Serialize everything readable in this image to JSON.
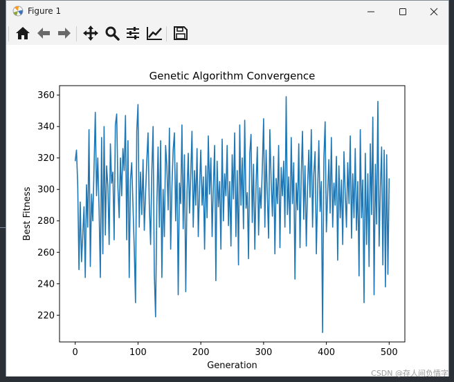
{
  "window": {
    "title": "Figure 1",
    "minimize_icon": "minimize-icon",
    "maximize_icon": "maximize-icon",
    "close_icon": "close-icon"
  },
  "toolbar": {
    "buttons": [
      {
        "name": "home",
        "icon": "home-icon"
      },
      {
        "name": "back",
        "icon": "arrow-left-icon"
      },
      {
        "name": "forward",
        "icon": "arrow-right-icon"
      },
      {
        "name": "pan",
        "icon": "move-icon"
      },
      {
        "name": "zoom",
        "icon": "magnifier-icon"
      },
      {
        "name": "configure-subplots",
        "icon": "sliders-icon"
      },
      {
        "name": "edit-axis",
        "icon": "line-chart-icon"
      },
      {
        "name": "save",
        "icon": "floppy-disk-icon"
      }
    ]
  },
  "chart_data": {
    "type": "line",
    "title": "Genetic Algorithm Convergence",
    "xlabel": "Generation",
    "ylabel": "Best Fitness",
    "xlim": [
      -25,
      525
    ],
    "ylim": [
      203,
      366
    ],
    "xticks": [
      0,
      100,
      200,
      300,
      400,
      500
    ],
    "yticks": [
      220,
      240,
      260,
      280,
      300,
      320,
      340,
      360
    ],
    "grid": false,
    "color": "#1f77b4",
    "series": [
      {
        "x": [
          0,
          2,
          4,
          6,
          8,
          10,
          12,
          14,
          16,
          18,
          20,
          22,
          24,
          26,
          28,
          30,
          32,
          34,
          36,
          38,
          40,
          42,
          44,
          46,
          48,
          50,
          52,
          54,
          56,
          58,
          60,
          62,
          64,
          66,
          68,
          70,
          72,
          74,
          76,
          78,
          80,
          82,
          84,
          86,
          88,
          90,
          92,
          94,
          96,
          98,
          100,
          102,
          104,
          106,
          108,
          110,
          112,
          114,
          116,
          118,
          120,
          122,
          124,
          126,
          128,
          130,
          132,
          134,
          136,
          138,
          140,
          142,
          144,
          146,
          148,
          150,
          152,
          154,
          156,
          158,
          160,
          162,
          164,
          166,
          168,
          170,
          172,
          174,
          176,
          178,
          180,
          182,
          184,
          186,
          188,
          190,
          192,
          194,
          196,
          198,
          200,
          202,
          204,
          206,
          208,
          210,
          212,
          214,
          216,
          218,
          220,
          222,
          224,
          226,
          228,
          230,
          232,
          234,
          236,
          238,
          240,
          242,
          244,
          246,
          248,
          250,
          252,
          254,
          256,
          258,
          260,
          262,
          264,
          266,
          268,
          270,
          272,
          274,
          276,
          278,
          280,
          282,
          284,
          286,
          288,
          290,
          292,
          294,
          296,
          298,
          300,
          302,
          304,
          306,
          308,
          310,
          312,
          314,
          316,
          318,
          320,
          322,
          324,
          326,
          328,
          330,
          332,
          334,
          336,
          338,
          340,
          342,
          344,
          346,
          348,
          350,
          352,
          354,
          356,
          358,
          360,
          362,
          364,
          366,
          368,
          370,
          372,
          374,
          376,
          378,
          380,
          382,
          384,
          386,
          388,
          390,
          392,
          394,
          396,
          398,
          400,
          402,
          404,
          406,
          408,
          410,
          412,
          414,
          416,
          418,
          420,
          422,
          424,
          426,
          428,
          430,
          432,
          434,
          436,
          438,
          440,
          442,
          444,
          446,
          448,
          450,
          452,
          454,
          456,
          458,
          460,
          462,
          464,
          466,
          468,
          470,
          472,
          474,
          476,
          478,
          480,
          482,
          484,
          486,
          488,
          490,
          492,
          494,
          496,
          498,
          500
        ],
        "y": [
          318,
          325,
          303,
          249,
          292,
          254,
          271,
          289,
          244,
          303,
          276,
          338,
          251,
          297,
          280,
          314,
          349,
          296,
          320,
          287,
          244,
          333,
          259,
          340,
          271,
          315,
          302,
          265,
          329,
          304,
          311,
          268,
          341,
          348,
          301,
          282,
          320,
          296,
          326,
          312,
          347,
          268,
          331,
          244,
          306,
          317,
          289,
          262,
          228,
          337,
          354,
          276,
          311,
          284,
          319,
          274,
          297,
          318,
          336,
          291,
          265,
          312,
          340,
          246,
          219,
          289,
          327,
          276,
          331,
          244,
          300,
          270,
          328,
          315,
          287,
          339,
          262,
          301,
          325,
          336,
          280,
          317,
          233,
          304,
          291,
          341,
          275,
          322,
          235,
          298,
          323,
          285,
          309,
          337,
          276,
          312,
          290,
          326,
          270,
          300,
          325,
          290,
          308,
          262,
          315,
          282,
          334,
          297,
          320,
          270,
          302,
          328,
          242,
          318,
          289,
          305,
          262,
          332,
          280,
          310,
          296,
          328,
          277,
          305,
          264,
          322,
          294,
          336,
          270,
          312,
          252,
          341,
          290,
          320,
          275,
          344,
          288,
          298,
          256,
          323,
          335,
          279,
          316,
          262,
          303,
          327,
          271,
          301,
          288,
          313,
          345,
          276,
          325,
          296,
          269,
          338,
          305,
          283,
          321,
          259,
          307,
          291,
          328,
          263,
          314,
          296,
          318,
          276,
          359,
          284,
          308,
          272,
          333,
          291,
          317,
          243,
          304,
          287,
          329,
          263,
          310,
          337,
          281,
          315,
          264,
          302,
          325,
          295,
          338,
          276,
          310,
          324,
          259,
          298,
          331,
          286,
          305,
          209,
          320,
          343,
          273,
          297,
          319,
          285,
          333,
          276,
          304,
          290,
          321,
          255,
          315,
          282,
          306,
          265,
          324,
          298,
          276,
          317,
          291,
          334,
          269,
          310,
          282,
          326,
          274,
          305,
          245,
          338,
          282,
          306,
          228,
          323,
          265,
          310,
          251,
          329,
          284,
          346,
          233,
          316,
          278,
          356,
          264,
          301,
          327,
          252,
          325,
          238,
          322,
          246,
          307
        ]
      }
    ]
  },
  "watermark": "CSDN @存人间负情字"
}
